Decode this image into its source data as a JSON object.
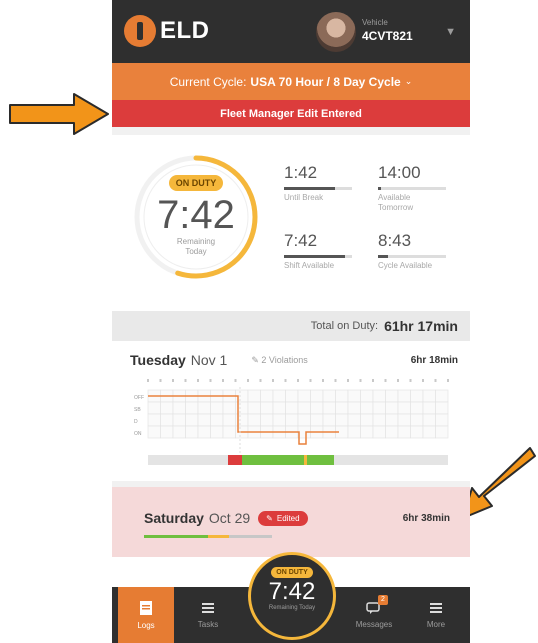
{
  "header": {
    "logo_text": "ELD",
    "vehicle_label": "Vehicle",
    "vehicle_id": "4CVT821"
  },
  "banners": {
    "cycle_prefix": "Current Cycle:",
    "cycle_value": "USA 70 Hour / 8 Day Cycle",
    "fleet_edit": "Fleet Manager Edit Entered"
  },
  "summary": {
    "status": "ON DUTY",
    "remaining_time": "7:42",
    "remaining_label": "Remaining Today",
    "gauge_fraction": 0.55,
    "stats": [
      {
        "value": "1:42",
        "label": "Until Break",
        "fill": 0.75
      },
      {
        "value": "14:00",
        "label": "Available Tomorrow",
        "fill": 0.05
      },
      {
        "value": "7:42",
        "label": "Shift Available",
        "fill": 0.9
      },
      {
        "value": "8:43",
        "label": "Cycle Available",
        "fill": 0.15
      }
    ]
  },
  "total_on_duty": {
    "label": "Total on Duty:",
    "value": "61hr 17min"
  },
  "days": [
    {
      "day": "Tuesday",
      "date": "Nov 1",
      "violations": "2 Violations",
      "hours": "6hr 18min",
      "rows": [
        "OFF",
        "SB",
        "D",
        "ON"
      ]
    },
    {
      "day": "Saturday",
      "date": "Oct 29",
      "edited_label": "Edited",
      "hours": "6hr 38min"
    }
  ],
  "nav": {
    "items": [
      {
        "label": "Logs"
      },
      {
        "label": "Tasks"
      },
      {
        "label": "Messages",
        "badge": "2"
      },
      {
        "label": "More"
      }
    ],
    "center": {
      "status": "ON DUTY",
      "time": "7:42",
      "label": "Remaining Today"
    }
  },
  "colors": {
    "orange": "#e9813c",
    "red": "#dc3c3c",
    "yellow": "#f5b73b",
    "dark": "#2f2f2f",
    "green": "#6fbf3f"
  }
}
